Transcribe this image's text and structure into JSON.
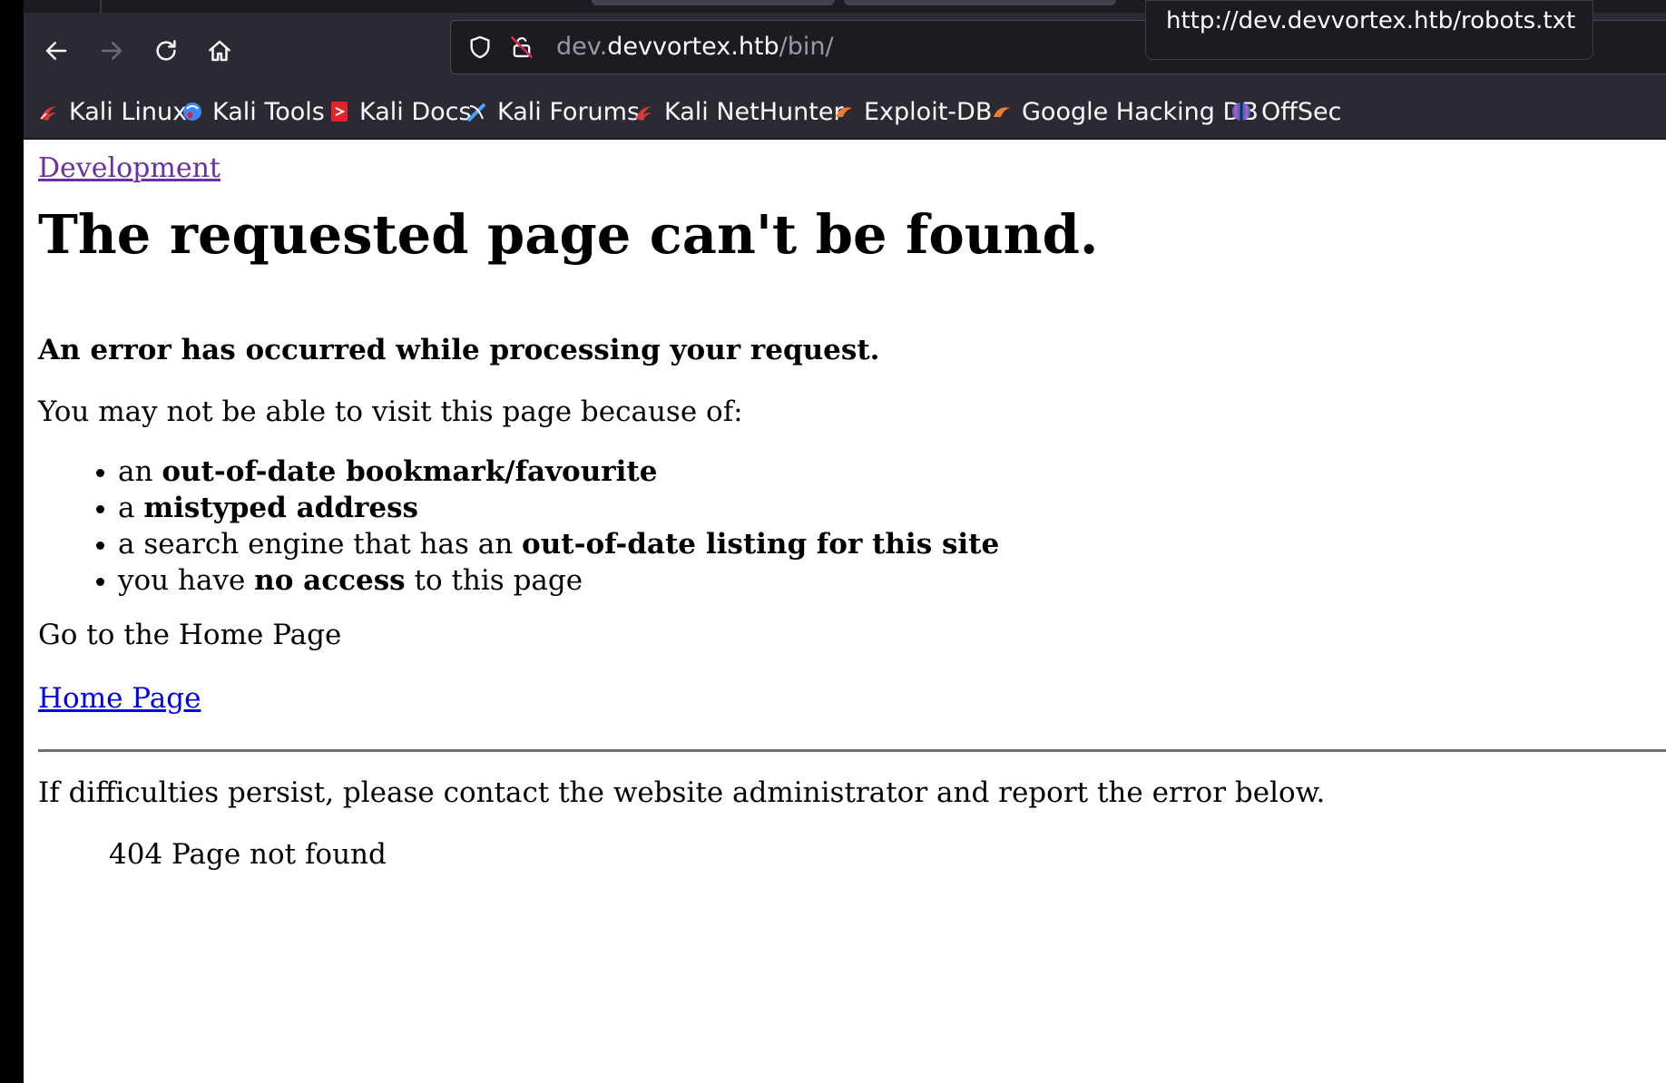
{
  "browser": {
    "tooltip_url": "http://dev.devvortex.htb/robots.txt",
    "url": {
      "subdomain": "dev.",
      "domain": "devvortex.htb",
      "path": "/bin/"
    },
    "nav_icons": [
      "back-icon",
      "forward-icon",
      "reload-icon",
      "home-icon"
    ],
    "bookmarks": [
      {
        "label": "Kali Linux",
        "icon": "kali-dragon-icon",
        "color": "#d63b3b"
      },
      {
        "label": "Kali Tools",
        "icon": "kali-tools-icon",
        "color": "#3d84ff"
      },
      {
        "label": "Kali Docs",
        "icon": "kali-docs-icon",
        "color": "#e0242a"
      },
      {
        "label": "Kali Forums",
        "icon": "kali-forums-icon",
        "color": "#4aa3ff"
      },
      {
        "label": "Kali NetHunter",
        "icon": "kali-nethunter-icon",
        "color": "#d63b3b"
      },
      {
        "label": "Exploit-DB",
        "icon": "exploit-db-icon",
        "color": "#f07c2a"
      },
      {
        "label": "Google Hacking DB",
        "icon": "ghdb-icon",
        "color": "#f07c2a"
      },
      {
        "label": "OffSec",
        "icon": "offsec-icon",
        "color": "#4b6bd6"
      }
    ]
  },
  "page": {
    "breadcrumb": "Development",
    "title": "The requested page can't be found.",
    "error_heading": "An error has occurred while processing your request.",
    "reason_intro": "You may not be able to visit this page because of:",
    "reasons": [
      {
        "pre": "an ",
        "bold": "out-of-date bookmark/favourite",
        "post": ""
      },
      {
        "pre": "a ",
        "bold": "mistyped address",
        "post": ""
      },
      {
        "pre": "a search engine that has an ",
        "bold": "out-of-date listing for this site",
        "post": ""
      },
      {
        "pre": "you have ",
        "bold": "no access",
        "post": " to this page"
      }
    ],
    "home_intro": "Go to the Home Page",
    "home_link": "Home Page",
    "persist_text": "If difficulties persist, please contact the website administrator and report the error below.",
    "error_code": "404 Page not found"
  }
}
